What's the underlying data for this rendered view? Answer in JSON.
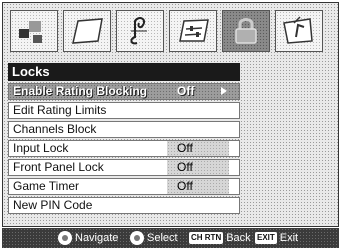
{
  "title": "Locks",
  "tabs": [
    {
      "icon": "picture-icon"
    },
    {
      "icon": "screen-icon"
    },
    {
      "icon": "music-note-icon"
    },
    {
      "icon": "settings-icon"
    },
    {
      "icon": "lock-icon",
      "active": true
    },
    {
      "icon": "setup-icon"
    }
  ],
  "menu": {
    "items": [
      {
        "label": "Enable Rating Blocking",
        "value": "Off",
        "selected": true
      },
      {
        "label": "Edit Rating Limits"
      },
      {
        "label": "Channels Block"
      },
      {
        "label": "Input Lock",
        "value": "Off"
      },
      {
        "label": "Front Panel Lock",
        "value": "Off"
      },
      {
        "label": "Game Timer",
        "value": "Off"
      },
      {
        "label": "New PIN Code"
      }
    ]
  },
  "footer": {
    "navigate": "Navigate",
    "select": "Select",
    "back_key": "CH RTN",
    "back": "Back",
    "exit_key": "EXIT",
    "exit": "Exit"
  }
}
